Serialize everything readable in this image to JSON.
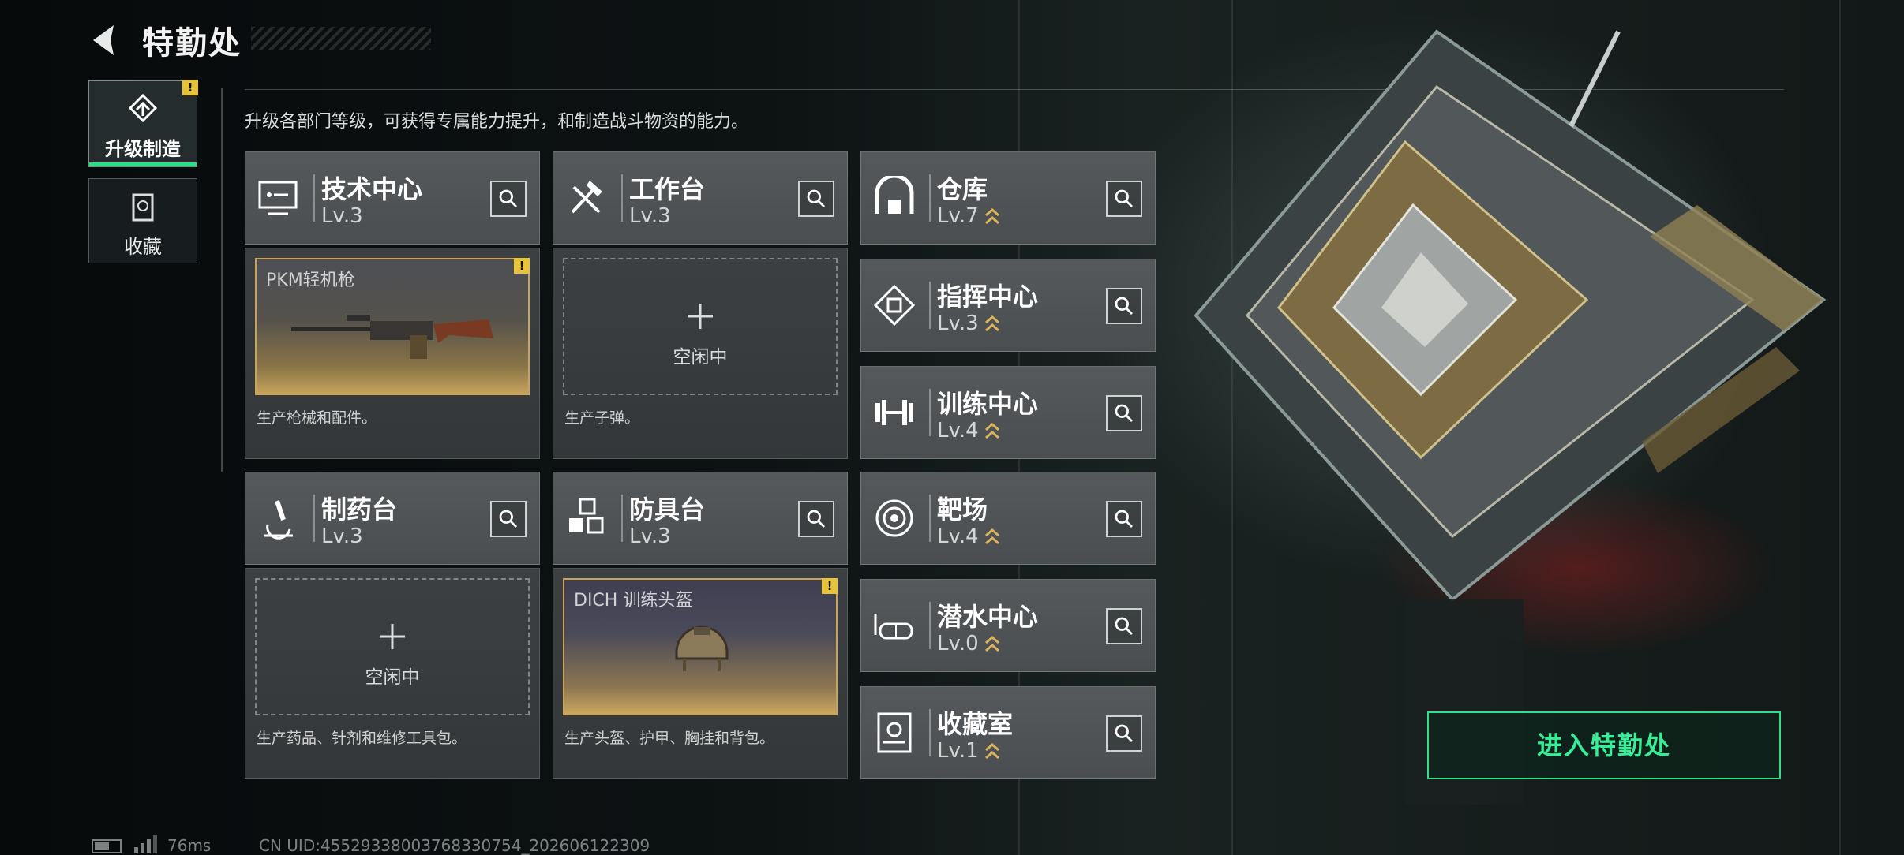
{
  "header": {
    "title": "特勤处",
    "back_icon": "back-arrow-icon"
  },
  "tabs": [
    {
      "label": "升级制造",
      "icon": "upgrade-craft-icon",
      "active": true,
      "alert": "!"
    },
    {
      "label": "收藏",
      "icon": "collection-icon",
      "active": false
    }
  ],
  "description": "升级各部门等级，可获得专属能力提升，和制造战斗物资的能力。",
  "departments": {
    "tech_center": {
      "name": "技术中心",
      "level": "Lv.3",
      "icon": "monitor-icon",
      "item": {
        "name": "PKM轻机枪",
        "alert": "!"
      },
      "desc": "生产枪械和配件。"
    },
    "workbench": {
      "name": "工作台",
      "level": "Lv.3",
      "icon": "tools-icon",
      "slot": "空闲中",
      "desc": "生产子弹。"
    },
    "pharmacy": {
      "name": "制药台",
      "level": "Lv.3",
      "icon": "microscope-icon",
      "slot": "空闲中",
      "desc": "生产药品、针剂和维修工具包。"
    },
    "armor_bench": {
      "name": "防具台",
      "level": "Lv.3",
      "icon": "armor-cubes-icon",
      "item": {
        "name": "DICH 训练头盔",
        "alert": "!"
      },
      "desc": "生产头盔、护甲、胸挂和背包。"
    },
    "warehouse": {
      "name": "仓库",
      "level": "Lv.7",
      "icon": "warehouse-icon",
      "upgradable": true
    },
    "command_center": {
      "name": "指挥中心",
      "level": "Lv.3",
      "icon": "command-chip-icon",
      "upgradable": true
    },
    "training_center": {
      "name": "训练中心",
      "level": "Lv.4",
      "icon": "dumbbell-icon",
      "upgradable": true
    },
    "shooting_range": {
      "name": "靶场",
      "level": "Lv.4",
      "icon": "target-icon",
      "upgradable": true
    },
    "diving_center": {
      "name": "潜水中心",
      "level": "Lv.0",
      "icon": "diving-mask-icon",
      "upgradable": true
    },
    "collection_room": {
      "name": "收藏室",
      "level": "Lv.1",
      "icon": "trophy-case-icon",
      "upgradable": true
    }
  },
  "enter_button": "进入特勤处",
  "status": {
    "ping": "76ms",
    "uid": "CN UID:4552933800376833075​4_202606122309"
  },
  "colors": {
    "accent_green": "#2ddd89",
    "alert_yellow": "#e8c33a",
    "upgrade_gold": "#d9b45a"
  }
}
